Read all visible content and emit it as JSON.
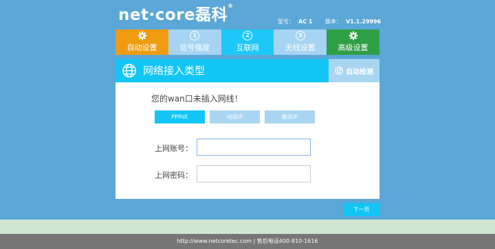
{
  "header": {
    "brand": "net·core磊科",
    "brand_mark": "®",
    "model_label": "型号：",
    "model_value": "AC 1",
    "version_label": "版本：",
    "version_value": "V1.1.29996"
  },
  "steps": [
    {
      "label": "自动设置",
      "icon": "gear-icon",
      "state": "auto"
    },
    {
      "label": "信号强度",
      "number": "1",
      "state": "done"
    },
    {
      "label": "互联网",
      "number": "2",
      "state": "active"
    },
    {
      "label": "无线设置",
      "number": "3",
      "state": "done"
    },
    {
      "label": "高级设置",
      "icon": "gear-icon",
      "state": "advanced"
    }
  ],
  "section": {
    "title": "网络接入类型",
    "auto_detect": "自动检测",
    "title_icon": "globe-icon",
    "detect_icon": "refresh-icon"
  },
  "panel": {
    "warning": "您的wan口未插入网线！",
    "modes": [
      "PPPoE",
      "动态IP",
      "静态IP"
    ],
    "selected_mode": "PPPoE",
    "account_label": "上网账号：",
    "account_value": "",
    "password_label": "上网密码：",
    "password_value": ""
  },
  "next_label": "下一页",
  "footer": "http://www.netcoretec.com | 售后电话400-810-1616",
  "colors": {
    "background": "#5aa7d8",
    "accent": "#12c5f5",
    "auto_tab": "#ef9c12",
    "advanced_tab": "#2f9f46",
    "inactive": "#a9d5f1"
  }
}
